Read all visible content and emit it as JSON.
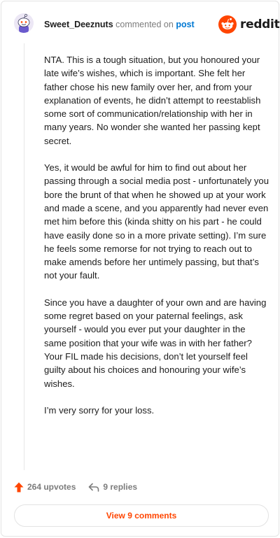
{
  "header": {
    "username": "Sweet_Deeznuts",
    "action_text": "commented on",
    "post_link": "post",
    "brand": "reddit"
  },
  "comment": {
    "paragraphs": [
      "NTA. This is a tough situation, but you honoured your late wife’s wishes, which is important. She felt her father chose his new family over her, and from your explanation of events, he didn’t attempt to reestablish some sort of communication/relationship with her in many years. No wonder she wanted her passing kept secret.",
      "Yes, it would be awful for him to find out about her passing through a social media post - unfortunately you bore the brunt of that when he showed up at your work and made a scene, and you apparently had never even met him before this (kinda shitty on his part - he could have easily done so in a more private setting). I’m sure he feels some remorse for not trying to reach out to make amends before her untimely passing, but that’s not your fault.",
      "Since you have a daughter of your own and are having some regret based on your paternal feelings, ask yourself - would you ever put your daughter in the same position that your wife was in with her father? Your FIL made his decisions, don’t let yourself feel guilty about his choices and honouring your wife’s wishes.",
      "I’m very sorry for your loss."
    ]
  },
  "footer": {
    "upvotes": "264 upvotes",
    "replies": "9 replies",
    "view_button": "View 9 comments"
  },
  "colors": {
    "brand_orange": "#ff4500",
    "link_blue": "#0079d3",
    "muted_gray": "#7c7c7c"
  },
  "icons": {
    "avatar": "snoo-avatar",
    "logo": "reddit-snoo-logo",
    "upvote": "upvote-arrow-icon",
    "reply": "reply-arrow-icon"
  }
}
